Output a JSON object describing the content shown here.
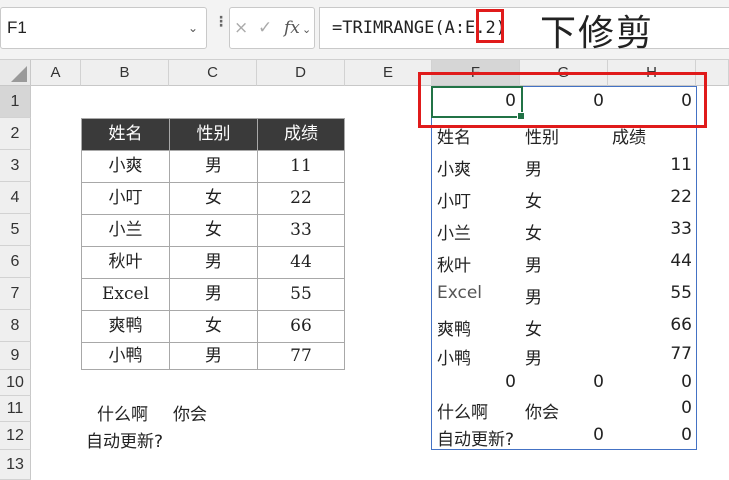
{
  "namebox": {
    "value": "F1"
  },
  "formula_bar": {
    "formula_prefix": "=TRIMRANGE(A:E",
    "formula_highlight": ".",
    "formula_suffix": "2)",
    "fx_label": "fx",
    "cancel_symbol": "×",
    "confirm_symbol": "✓"
  },
  "annotation": "下修剪",
  "columns": [
    "A",
    "B",
    "C",
    "D",
    "E",
    "F",
    "G",
    "H"
  ],
  "rows": [
    "1",
    "2",
    "3",
    "4",
    "5",
    "6",
    "7",
    "8",
    "9",
    "10",
    "11",
    "12",
    "13"
  ],
  "table": {
    "headers": [
      "姓名",
      "性别",
      "成绩"
    ],
    "rows": [
      [
        "小爽",
        "男",
        "11"
      ],
      [
        "小叮",
        "女",
        "22"
      ],
      [
        "小兰",
        "女",
        "33"
      ],
      [
        "秋叶",
        "男",
        "44"
      ],
      [
        "Excel",
        "男",
        "55"
      ],
      [
        "爽鸭",
        "女",
        "66"
      ],
      [
        "小鸭",
        "男",
        "77"
      ]
    ]
  },
  "free_text": {
    "row11_b": "什么啊",
    "row11_c": "你会",
    "row12_b": "自动更新?"
  },
  "spill": [
    [
      "0",
      "0",
      "0"
    ],
    [
      "姓名",
      "性别",
      "成绩"
    ],
    [
      "小爽",
      "男",
      "11"
    ],
    [
      "小叮",
      "女",
      "22"
    ],
    [
      "小兰",
      "女",
      "33"
    ],
    [
      "秋叶",
      "男",
      "44"
    ],
    [
      "Excel",
      "男",
      "55"
    ],
    [
      "爽鸭",
      "女",
      "66"
    ],
    [
      "小鸭",
      "男",
      "77"
    ],
    [
      "0",
      "0",
      "0"
    ],
    [
      "什么啊",
      "你会",
      "0"
    ],
    [
      "自动更新?",
      "0",
      "0"
    ]
  ],
  "colors": {
    "accent_green": "#217346",
    "spill_border": "#4472c4",
    "highlight_red": "#e01b1b",
    "header_dark": "#3a3a3a"
  }
}
